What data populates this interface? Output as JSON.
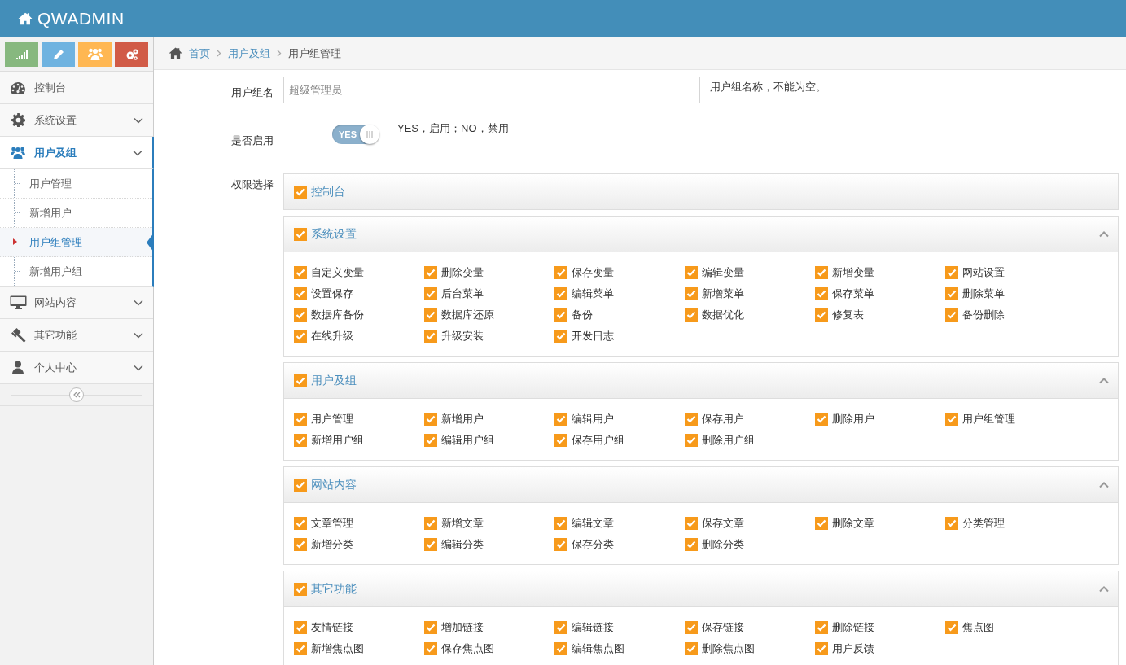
{
  "header": {
    "title": "QWADMIN"
  },
  "shortcuts": [
    {
      "color": "#87b87f"
    },
    {
      "color": "#6fb3e0"
    },
    {
      "color": "#ffb752"
    },
    {
      "color": "#d15b47"
    }
  ],
  "sidebar": {
    "items": [
      {
        "label": "控制台",
        "kind": "link",
        "selected": false
      },
      {
        "label": "系统设置",
        "kind": "dropdown",
        "expanded": false,
        "selected": false
      },
      {
        "label": "用户及组",
        "kind": "dropdown",
        "expanded": true,
        "selected": true,
        "children": [
          {
            "label": "用户管理",
            "selected": false
          },
          {
            "label": "新增用户",
            "selected": false
          },
          {
            "label": "用户组管理",
            "selected": true
          },
          {
            "label": "新增用户组",
            "selected": false
          }
        ]
      },
      {
        "label": "网站内容",
        "kind": "dropdown",
        "expanded": false,
        "selected": false
      },
      {
        "label": "其它功能",
        "kind": "dropdown",
        "expanded": false,
        "selected": false
      },
      {
        "label": "个人中心",
        "kind": "dropdown",
        "expanded": false,
        "selected": false
      }
    ]
  },
  "breadcrumb": [
    {
      "label": "首页",
      "kind": "link"
    },
    {
      "label": "用户及组",
      "kind": "link"
    },
    {
      "label": "用户组管理",
      "kind": "current"
    }
  ],
  "form": {
    "group_name": {
      "label": "用户组名",
      "value": "超级管理员",
      "hint": "用户组名称，不能为空。"
    },
    "enabled": {
      "label": "是否启用",
      "on": true,
      "toggle_text": "YES",
      "hint": "YES，启用；NO，禁用"
    },
    "permissions": {
      "label": "权限选择",
      "groups": [
        {
          "title": "控制台",
          "kind": "leaf",
          "checked": true
        },
        {
          "title": "系统设置",
          "kind": "group",
          "checked": true,
          "expanded": true,
          "items": [
            {
              "label": "自定义变量",
              "checked": true
            },
            {
              "label": "删除变量",
              "checked": true
            },
            {
              "label": "保存变量",
              "checked": true
            },
            {
              "label": "编辑变量",
              "checked": true
            },
            {
              "label": "新增变量",
              "checked": true
            },
            {
              "label": "网站设置",
              "checked": true
            },
            {
              "label": "设置保存",
              "checked": true
            },
            {
              "label": "后台菜单",
              "checked": true
            },
            {
              "label": "编辑菜单",
              "checked": true
            },
            {
              "label": "新增菜单",
              "checked": true
            },
            {
              "label": "保存菜单",
              "checked": true
            },
            {
              "label": "删除菜单",
              "checked": true
            },
            {
              "label": "数据库备份",
              "checked": true
            },
            {
              "label": "数据库还原",
              "checked": true
            },
            {
              "label": "备份",
              "checked": true
            },
            {
              "label": "数据优化",
              "checked": true
            },
            {
              "label": "修复表",
              "checked": true
            },
            {
              "label": "备份删除",
              "checked": true
            },
            {
              "label": "在线升级",
              "checked": true
            },
            {
              "label": "升级安装",
              "checked": true
            },
            {
              "label": "开发日志",
              "checked": true
            }
          ]
        },
        {
          "title": "用户及组",
          "kind": "group",
          "checked": true,
          "expanded": true,
          "items": [
            {
              "label": "用户管理",
              "checked": true
            },
            {
              "label": "新增用户",
              "checked": true
            },
            {
              "label": "编辑用户",
              "checked": true
            },
            {
              "label": "保存用户",
              "checked": true
            },
            {
              "label": "删除用户",
              "checked": true
            },
            {
              "label": "用户组管理",
              "checked": true
            },
            {
              "label": "新增用户组",
              "checked": true
            },
            {
              "label": "编辑用户组",
              "checked": true
            },
            {
              "label": "保存用户组",
              "checked": true
            },
            {
              "label": "删除用户组",
              "checked": true
            }
          ]
        },
        {
          "title": "网站内容",
          "kind": "group",
          "checked": true,
          "expanded": true,
          "items": [
            {
              "label": "文章管理",
              "checked": true
            },
            {
              "label": "新增文章",
              "checked": true
            },
            {
              "label": "编辑文章",
              "checked": true
            },
            {
              "label": "保存文章",
              "checked": true
            },
            {
              "label": "删除文章",
              "checked": true
            },
            {
              "label": "分类管理",
              "checked": true
            },
            {
              "label": "新增分类",
              "checked": true
            },
            {
              "label": "编辑分类",
              "checked": true
            },
            {
              "label": "保存分类",
              "checked": true
            },
            {
              "label": "删除分类",
              "checked": true
            }
          ]
        },
        {
          "title": "其它功能",
          "kind": "group",
          "checked": true,
          "expanded": true,
          "items": [
            {
              "label": "友情链接",
              "checked": true
            },
            {
              "label": "增加链接",
              "checked": true
            },
            {
              "label": "编辑链接",
              "checked": true
            },
            {
              "label": "保存链接",
              "checked": true
            },
            {
              "label": "删除链接",
              "checked": true
            },
            {
              "label": "焦点图",
              "checked": true
            },
            {
              "label": "新增焦点图",
              "checked": true
            },
            {
              "label": "保存焦点图",
              "checked": true
            },
            {
              "label": "编辑焦点图",
              "checked": true
            },
            {
              "label": "删除焦点图",
              "checked": true
            },
            {
              "label": "用户反馈",
              "checked": true
            }
          ]
        }
      ]
    }
  }
}
